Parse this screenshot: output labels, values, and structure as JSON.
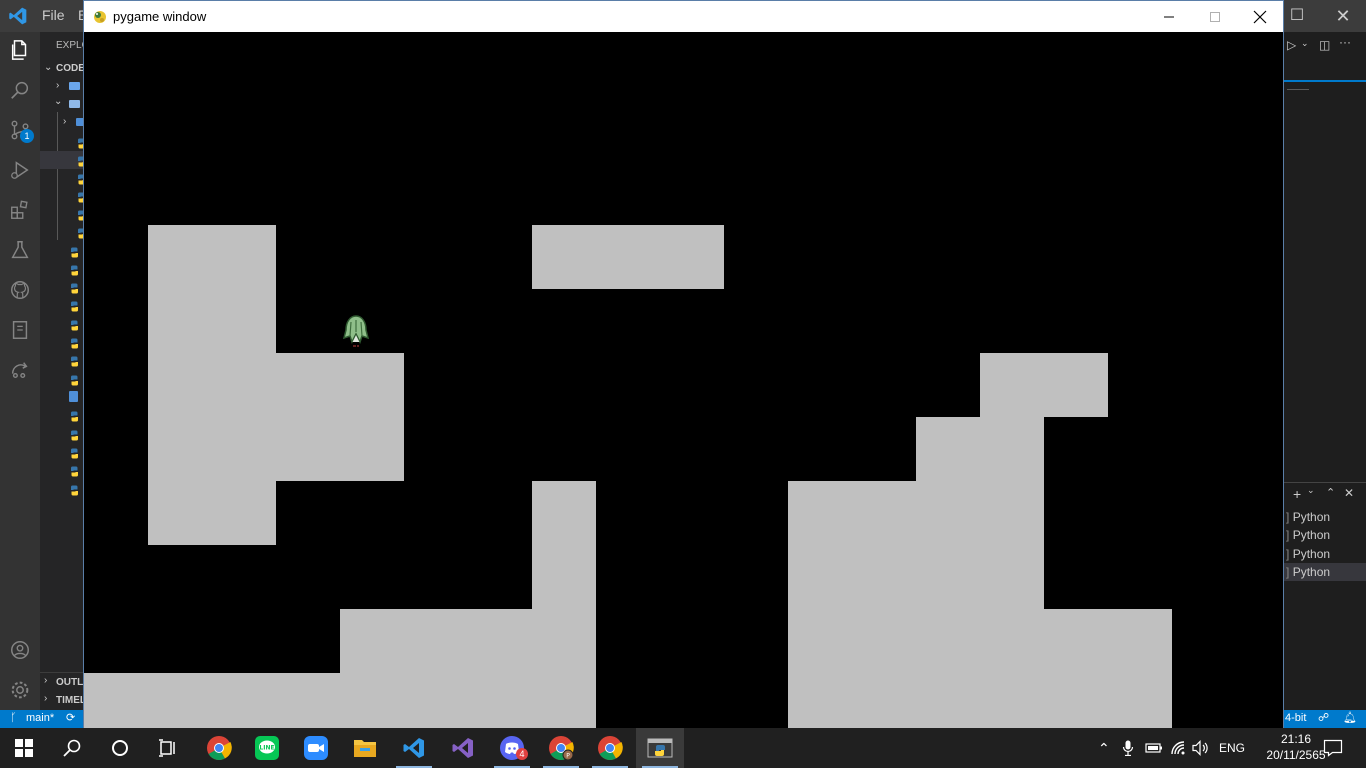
{
  "vscode": {
    "menu_file": "File",
    "menu_edit_partial": "E",
    "explorer_label": "EXPLO",
    "workspace_label": "CODE",
    "outline_label": "OUTLI",
    "timeline_label": "TIMEL",
    "source_control_badge": "1",
    "terminals": [
      "Python",
      "Python",
      "Python",
      "Python"
    ],
    "status_branch": "main*",
    "status_right_text": "4-bit"
  },
  "pygame": {
    "title": "pygame window",
    "background_color": "#000000",
    "tile_color": "#c0c0c0"
  },
  "taskbar": {
    "apps": [
      "start-icon",
      "search-icon",
      "cortana-icon",
      "task-view-icon",
      "chrome-icon",
      "line-icon",
      "zoom-icon",
      "file-explorer-icon",
      "vscode-icon",
      "visual-studio-icon",
      "discord-icon",
      "chrome-profile-icon",
      "chrome-icon",
      "python-icon"
    ],
    "discord_badge": "4",
    "language": "ENG",
    "time": "21:16",
    "date": "20/11/2565"
  }
}
